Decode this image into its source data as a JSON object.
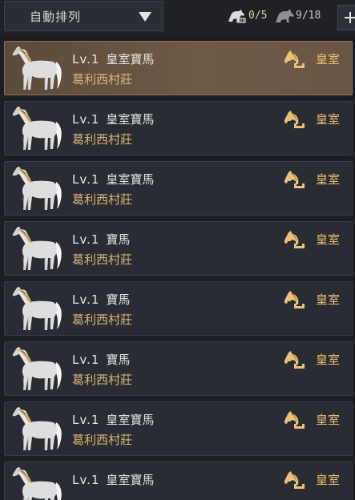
{
  "toolbar": {
    "sort_label": "自動排列",
    "stall_count": "0/5",
    "horse_count": "9/18"
  },
  "horses": [
    {
      "level": "Lv.1",
      "name": "皇室寶馬",
      "location": "葛利西村莊",
      "tier": "皇室",
      "selected": true
    },
    {
      "level": "Lv.1",
      "name": "皇室寶馬",
      "location": "葛利西村莊",
      "tier": "皇室",
      "selected": false
    },
    {
      "level": "Lv.1",
      "name": "皇室寶馬",
      "location": "葛利西村莊",
      "tier": "皇室",
      "selected": false
    },
    {
      "level": "Lv.1",
      "name": "寶馬",
      "location": "葛利西村莊",
      "tier": "皇室",
      "selected": false
    },
    {
      "level": "Lv.1",
      "name": "寶馬",
      "location": "葛利西村莊",
      "tier": "皇室",
      "selected": false
    },
    {
      "level": "Lv.1",
      "name": "寶馬",
      "location": "葛利西村莊",
      "tier": "皇室",
      "selected": false
    },
    {
      "level": "Lv.1",
      "name": "皇室寶馬",
      "location": "葛利西村莊",
      "tier": "皇室",
      "selected": false
    },
    {
      "level": "Lv.1",
      "name": "皇室寶馬",
      "location": "",
      "tier": "皇室",
      "selected": false
    }
  ],
  "icons": {
    "sort_caret": "triangle-down-icon",
    "stall": "horse-stall-icon",
    "horse": "horse-count-icon",
    "tier": "horse-head-icon",
    "add": "plus-icon"
  },
  "colors": {
    "title_text": "#e6e6e6",
    "location_text": "#d5b77c",
    "tier_text": "#e9bf73",
    "selected_row": "#6e5946"
  }
}
